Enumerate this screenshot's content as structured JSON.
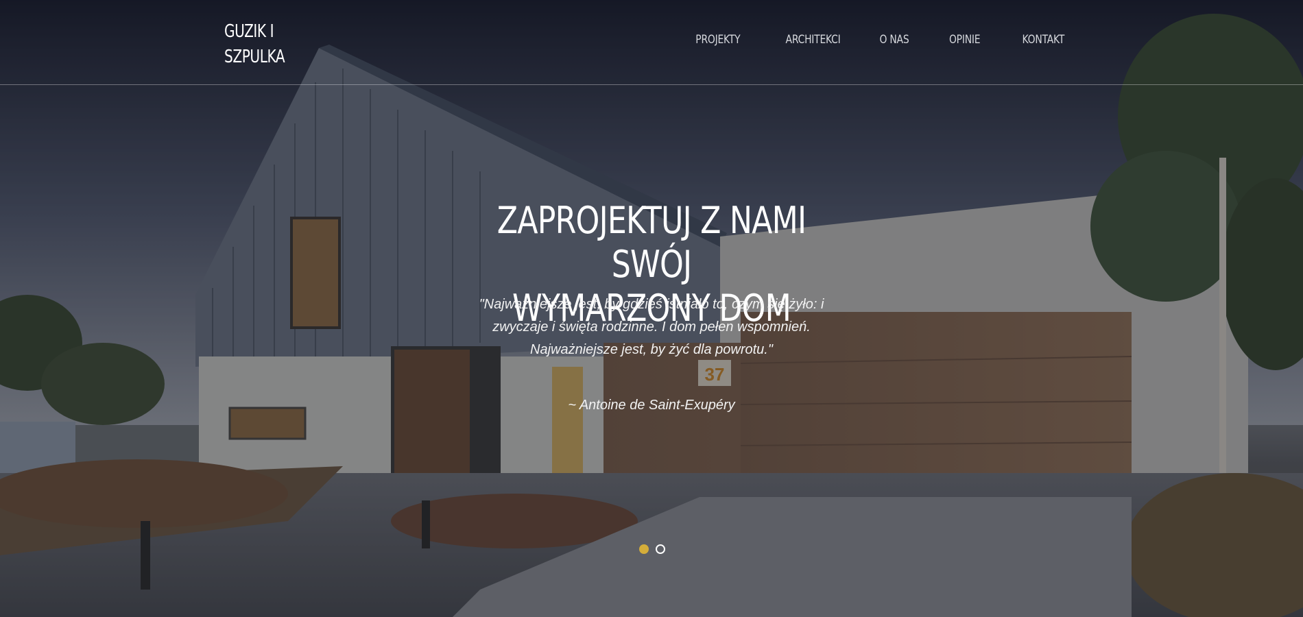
{
  "brand": {
    "line1": "GUZIK I",
    "line2": "SZPULKA"
  },
  "nav": {
    "items": [
      {
        "label": "PROJEKTY"
      },
      {
        "label": "ARCHITEKCI"
      },
      {
        "label": "O NAS"
      },
      {
        "label": "OPINIE"
      },
      {
        "label": "KONTAKT"
      }
    ]
  },
  "hero": {
    "headline_line1": "ZAPROJEKTUJ Z NAMI SWÓJ",
    "headline_line2": "WYMARZONY DOM",
    "quote_line1": "\"Najważniejsze jest, by gdzieś istniało to, czym się żyło: i",
    "quote_line2": "zwyczaje i święta rodzinne. I dom pełen wspomnień.",
    "quote_line3": "Najważniejsze jest, by żyć dla powrotu.\"",
    "author": "~ Antoine de Saint-Exupéry",
    "house_number": "37"
  },
  "slider": {
    "slide_count": 2,
    "active_index": 0
  },
  "colors": {
    "accent_dot": "#d4ad3a",
    "text": "#ffffff"
  }
}
